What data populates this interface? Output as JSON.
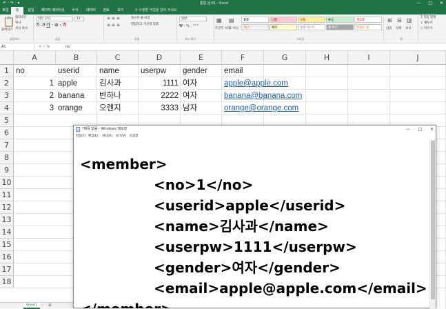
{
  "excel": {
    "qat": "↶ · ↷ · ▾",
    "window_title": "통합 문서1 - Excel",
    "window_buttons": [
      "—",
      "□",
      "✕"
    ],
    "tabs": [
      "파일",
      "홈",
      "삽입",
      "페이지 레이아웃",
      "수식",
      "데이터",
      "검토",
      "보기"
    ],
    "active_tab": "홈",
    "tell_me": "♀ 수행할 작업을 알려 주세요",
    "ribbon": {
      "clipboard": {
        "paste": "붙여넣기",
        "cut": "잘라내기",
        "copy": "복사",
        "format": "서식 복사",
        "label": "클립보드"
      },
      "font": {
        "name": "맑은 고딕",
        "size": "11",
        "label": "글꼴"
      },
      "alignment": {
        "wrap": "텍스트 줄 바꿈",
        "merge": "병합하고 가운데 맞춤",
        "label": "맞춤"
      },
      "number": {
        "format": "일반",
        "label": "표시 형식"
      },
      "styles": {
        "conditional": "조건부 서식",
        "table": "표 서식",
        "cells": [
          {
            "text": "표준",
            "bg": "#ffffff",
            "color": "#000000"
          },
          {
            "text": "나쁨",
            "bg": "#ffc7ce",
            "color": "#9c0006"
          },
          {
            "text": "보통",
            "bg": "#ffeb9c",
            "color": "#9c5700"
          },
          {
            "text": "좋음",
            "bg": "#c6efce",
            "color": "#006100"
          },
          {
            "text": "경고문",
            "bg": "#ffffff",
            "color": "#ff0000"
          },
          {
            "text": "계산",
            "bg": "#f2f2f2",
            "color": "#fa7d00"
          },
          {
            "text": "메모",
            "bg": "#ffffcc",
            "color": "#000000"
          },
          {
            "text": "설명 텍스트",
            "bg": "#ffffff",
            "color": "#7f7f7f"
          },
          {
            "text": "셀 확인",
            "bg": "#a5a5a5",
            "color": "#ffffff"
          },
          {
            "text": "연결된 셀",
            "bg": "#ffffff",
            "color": "#fa7d00"
          }
        ],
        "label": "스타일"
      },
      "cells": {
        "insert": "삽입",
        "delete": "삭제",
        "format": "서식",
        "label": "셀"
      },
      "editing": {
        "autosum": "자동 합계",
        "fill": "채우기",
        "clear": "지우기"
      }
    },
    "name_box": "A1",
    "fx": "✕ ✓ fx",
    "formula_value": "no",
    "columns": [
      "A",
      "B",
      "C",
      "D",
      "E",
      "F",
      "G",
      "H",
      "I",
      "J"
    ],
    "rows": [
      "1",
      "2",
      "3",
      "4",
      "5",
      "6",
      "7",
      "8",
      "9",
      "10",
      "11",
      "12",
      "13",
      "14",
      "15",
      "16",
      "17",
      "18"
    ],
    "data": {
      "header": [
        "no",
        "userid",
        "name",
        "userpw",
        "gender",
        "email"
      ],
      "records": [
        [
          "1",
          "apple",
          "김사과",
          "1111",
          "여자",
          "apple@apple.com"
        ],
        [
          "2",
          "banana",
          "반하나",
          "2222",
          "여자",
          "banana@banana.com"
        ],
        [
          "3",
          "orange",
          "오렌지",
          "3333",
          "남자",
          "orange@orange.com"
        ]
      ]
    },
    "sheet_tab": "Sheet1",
    "add_sheet": "⊕"
  },
  "notepad": {
    "title": "*제목 없음 - Windows 메모장",
    "window_buttons": [
      "—",
      "□",
      "✕"
    ],
    "menu": [
      "파일(F)",
      "편집(E)",
      "서식(O)",
      "보기(V)",
      "도움말"
    ],
    "lines": [
      "<member>",
      "<no>1</no>",
      "<userid>apple</userid>",
      "<name>김사과</name>",
      "<userpw>1111</userpw>",
      "<gender>여자</gender>",
      "<email>apple@apple.com</email>",
      "</member>"
    ]
  }
}
